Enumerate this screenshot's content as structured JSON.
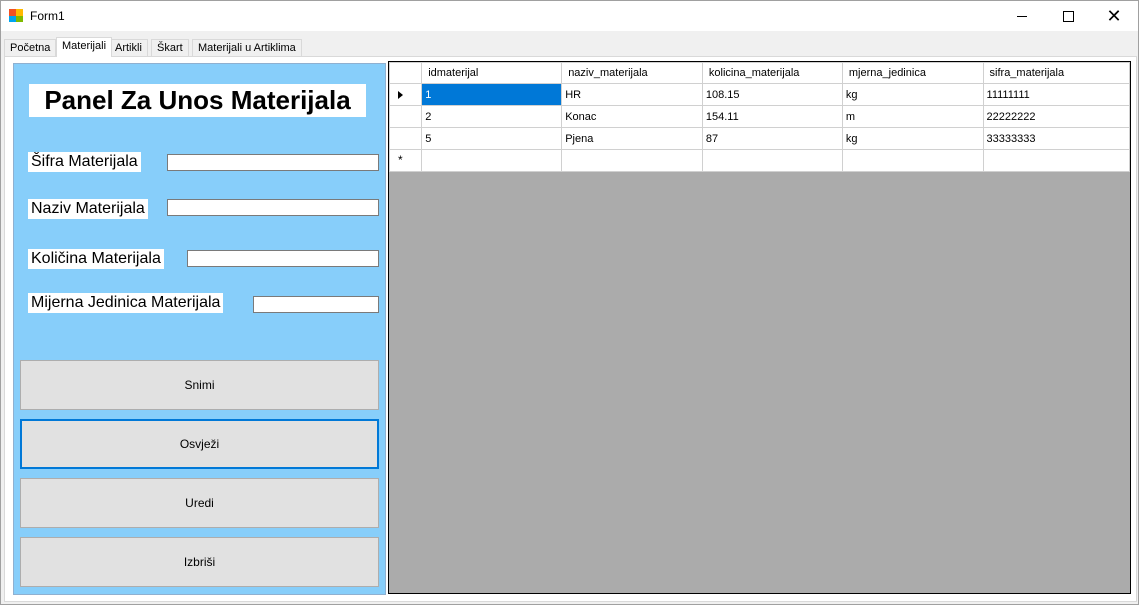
{
  "window": {
    "title": "Form1",
    "minimize_icon": "minimize-icon",
    "maximize_icon": "maximize-icon",
    "close_icon": "close-icon"
  },
  "tabs": [
    {
      "label": "Početna"
    },
    {
      "label": "Materijali"
    },
    {
      "label": "Artikli"
    },
    {
      "label": "Škart"
    },
    {
      "label": "Materijali u Artiklima"
    }
  ],
  "panel": {
    "title": "Panel Za Unos Materijala",
    "background_color": "#87cefa",
    "fields": [
      {
        "label": "Šifra Materijala",
        "value": ""
      },
      {
        "label": "Naziv Materijala",
        "value": ""
      },
      {
        "label": "Količina Materijala",
        "value": ""
      },
      {
        "label": "Mijerna Jedinica Materijala",
        "value": ""
      }
    ],
    "buttons": {
      "save": "Snimi",
      "refresh": "Osvježi",
      "edit": "Uredi",
      "delete": "Izbriši"
    }
  },
  "grid": {
    "columns": [
      "idmaterijal",
      "naziv_materijala",
      "kolicina_materijala",
      "mjerna_jedinica",
      "sifra_materijala"
    ],
    "rows": [
      [
        "1",
        "HR",
        "108.15",
        "kg",
        "11111111"
      ],
      [
        "2",
        "Konac",
        "154.11",
        "m",
        "22222222"
      ],
      [
        "5",
        "Pjena",
        "87",
        "kg",
        "33333333"
      ]
    ],
    "new_row_marker": "*",
    "selection_color": "#0078d7"
  }
}
